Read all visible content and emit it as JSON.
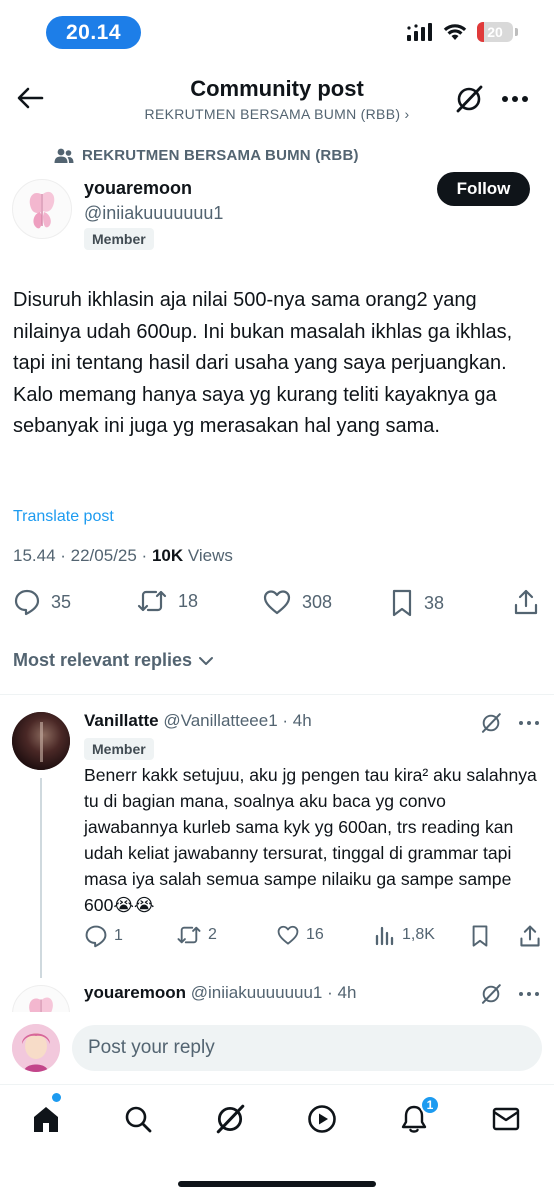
{
  "status_bar": {
    "time": "20.14",
    "battery": "20",
    "battery_level": 0.2
  },
  "header": {
    "title": "Community post",
    "subtitle": "REKRUTMEN BERSAMA BUMN (RBB) ›"
  },
  "post": {
    "community": "REKRUTMEN BERSAMA BUMN (RBB)",
    "author_name": "youaremoon",
    "author_handle": "@iniiakuuuuuuu1",
    "badge": "Member",
    "follow_label": "Follow",
    "text": "Disuruh ikhlasin aja nilai 500-nya sama orang2 yang nilainya udah 600up. Ini bukan masalah ikhlas ga ikhlas, tapi ini tentang hasil dari usaha yang saya perjuangkan. Kalo memang hanya saya yg kurang teliti kayaknya ga sebanyak ini juga yg merasakan hal yang sama.",
    "translate_label": "Translate post",
    "timestamp": "15.44 · 22/05/25 · ",
    "views_count": "10K",
    "views_label": " Views",
    "stats": {
      "replies": "35",
      "reposts": "18",
      "likes": "308",
      "bookmarks": "38"
    }
  },
  "replies_sort_label": "Most relevant replies",
  "replies": [
    {
      "name": "Vanillatte",
      "handle_time": " @Vanillatteee1 · 4h",
      "badge": "Member",
      "text": "Benerr kakk setujuu, aku jg pengen tau kira² aku salahnya tu di bagian mana, soalnya aku baca yg convo jawabannya kurleb sama kyk yg 600an, trs reading kan udah keliat jawabanny tersurat, tinggal di grammar tapi masa iya salah semua sampe nilaiku ga sampe sampe 600😭😭",
      "stats": {
        "replies": "1",
        "reposts": "2",
        "likes": "16",
        "views": "1,8K"
      }
    },
    {
      "name": "youaremoon",
      "handle_time": " @iniiakuuuuuuu1 · 4h"
    }
  ],
  "composer": {
    "placeholder": "Post your reply"
  },
  "nav": {
    "notifications_count": "1"
  },
  "colors": {
    "accent": "#1d9bf0",
    "status_pill": "#1d7ee8",
    "text": "#0f1419",
    "muted": "#536471"
  }
}
